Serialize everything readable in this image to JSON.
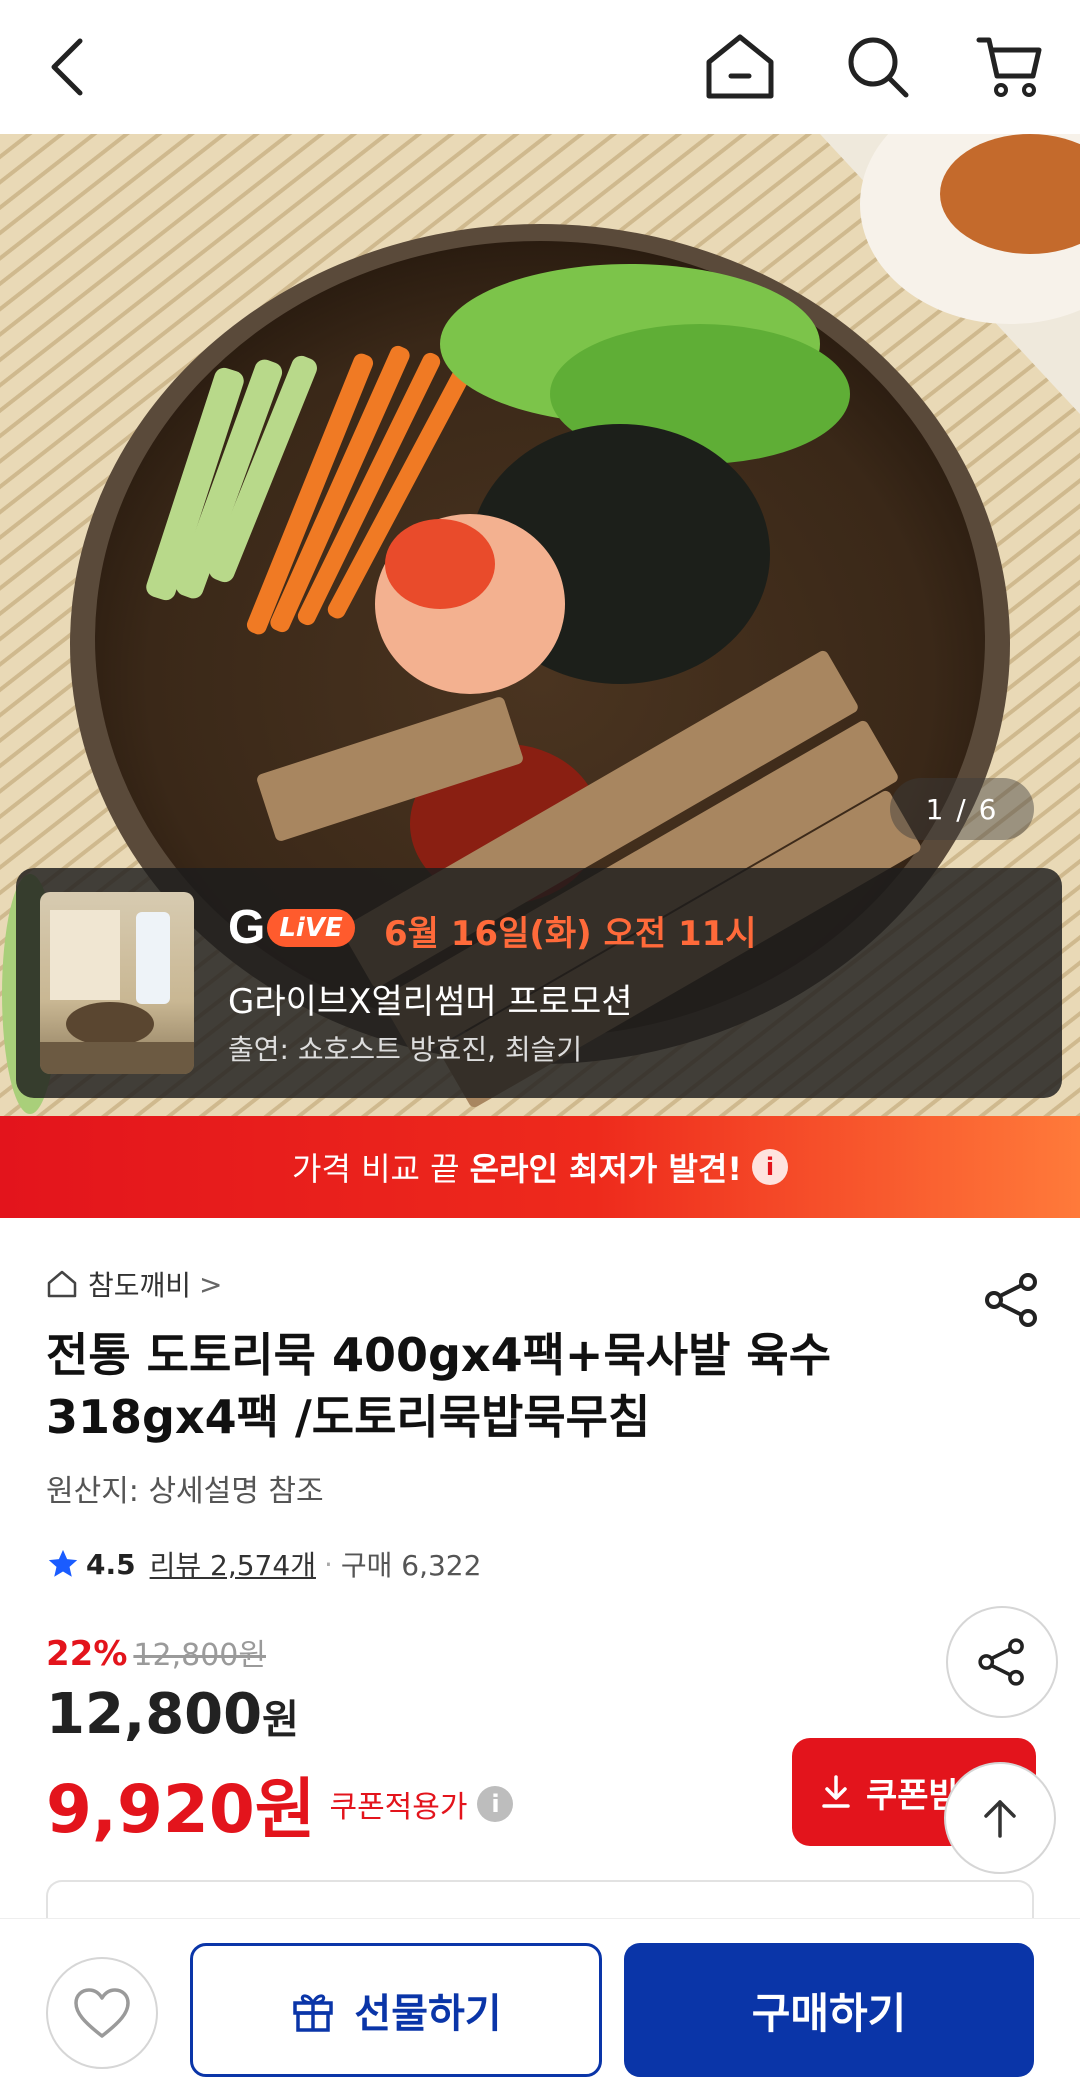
{
  "topbar": {
    "icons": [
      "back-icon",
      "home-icon",
      "search-icon",
      "cart-icon"
    ]
  },
  "hero": {
    "page_indicator": "1 / 6",
    "live": {
      "badge": "LiVE",
      "brand_letter": "G",
      "date": "6월 16일(화) 오전 11시",
      "title": "G라이브X얼리썸머 프로모션",
      "cast": "출연: 쇼호스트 방효진, 최슬기"
    }
  },
  "compare_banner": {
    "text": "가격 비교 끝",
    "highlight": "온라인 최저가 발견!",
    "info": "i"
  },
  "product": {
    "store": "참도깨비",
    "store_chevron": ">",
    "title": "전통 도토리묵 400gx4팩+묵사발 육수 318gx4팩 /도토리묵밥묵무침",
    "origin": "원산지: 상세설명 참조",
    "rating": "4.5",
    "reviews": "리뷰 2,574개",
    "dot": "·",
    "purchases": "구매 6,322",
    "discount_pct": "22%",
    "original_price": "12,800원",
    "price_value": "12,800",
    "price_unit": "원",
    "coupon_price_value": "9,920원",
    "coupon_label": "쿠폰적용가",
    "coupon_info": "i",
    "coupon_button": "쿠폰받"
  },
  "bottom": {
    "gift": "선물하기",
    "buy": "구매하기"
  },
  "colors": {
    "brand_blue": "#0a35a8",
    "accent_red": "#e3141c",
    "live_orange": "#ff5b2d"
  }
}
